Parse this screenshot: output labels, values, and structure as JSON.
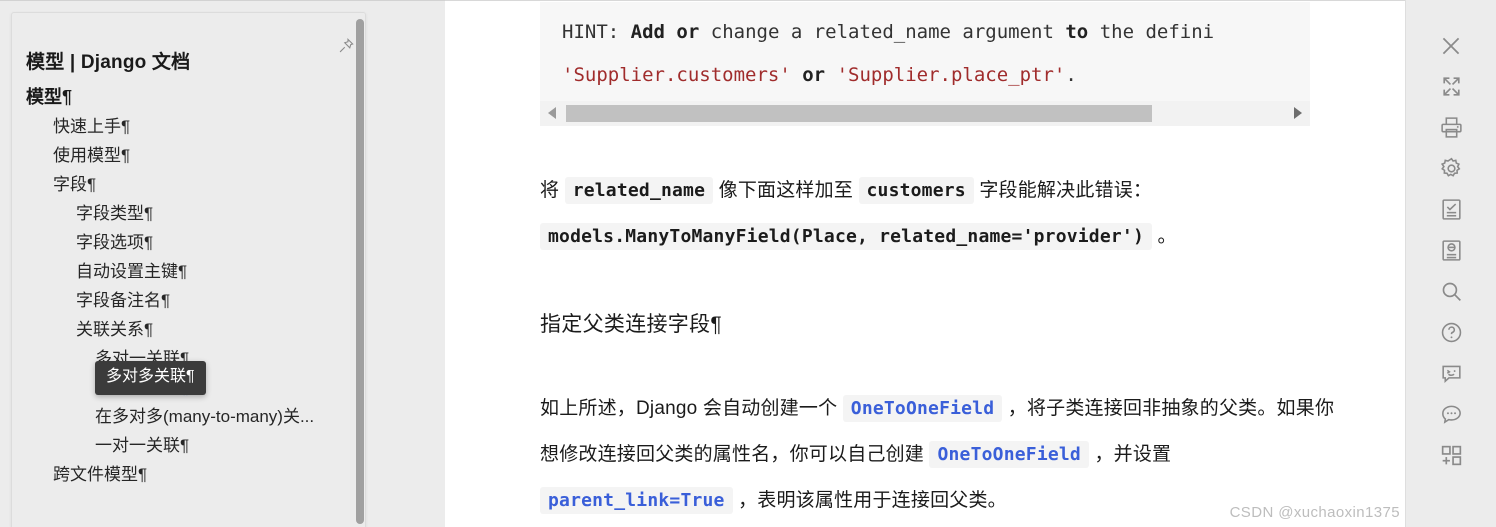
{
  "outline": {
    "title": "模型 | Django 文档",
    "pin_icon": "pin-icon",
    "items": [
      {
        "label": "模型¶",
        "level": 1,
        "bold": true,
        "active": false
      },
      {
        "label": "快速上手¶",
        "level": 2,
        "bold": false,
        "active": false
      },
      {
        "label": "使用模型¶",
        "level": 2,
        "bold": false,
        "active": false
      },
      {
        "label": "字段¶",
        "level": 2,
        "bold": false,
        "active": false
      },
      {
        "label": "字段类型¶",
        "level": 3,
        "bold": false,
        "active": false
      },
      {
        "label": "字段选项¶",
        "level": 3,
        "bold": false,
        "active": false
      },
      {
        "label": "自动设置主键¶",
        "level": 3,
        "bold": false,
        "active": false
      },
      {
        "label": "字段备注名¶",
        "level": 3,
        "bold": false,
        "active": false
      },
      {
        "label": "关联关系¶",
        "level": 3,
        "bold": false,
        "active": false
      },
      {
        "label": "多对一关联¶",
        "level": 4,
        "bold": false,
        "active": false
      },
      {
        "label": "多对多关联¶",
        "level": 4,
        "bold": false,
        "active": true
      },
      {
        "label": "在多对多(many-to-many)关...",
        "level": 4,
        "bold": false,
        "active": false
      },
      {
        "label": "一对一关联¶",
        "level": 4,
        "bold": false,
        "active": false
      },
      {
        "label": "跨文件模型¶",
        "level": 2,
        "bold": false,
        "active": false
      }
    ],
    "tooltip": "多对多关联¶"
  },
  "document": {
    "code_block": {
      "line1": [
        {
          "text": "HINT: ",
          "style": "plain"
        },
        {
          "text": "Add",
          "style": "kw"
        },
        {
          "text": " ",
          "style": "plain"
        },
        {
          "text": "or",
          "style": "kw"
        },
        {
          "text": " change a related_name argument ",
          "style": "plain"
        },
        {
          "text": "to",
          "style": "kw"
        },
        {
          "text": " the defini",
          "style": "plain"
        }
      ],
      "line2": [
        {
          "text": "'Supplier.customers'",
          "style": "str"
        },
        {
          "text": " ",
          "style": "plain"
        },
        {
          "text": "or",
          "style": "kw"
        },
        {
          "text": " ",
          "style": "plain"
        },
        {
          "text": "'Supplier.place_ptr'",
          "style": "str"
        },
        {
          "text": ".",
          "style": "plain"
        }
      ]
    },
    "para_1": [
      {
        "text": "将 ",
        "style": "text"
      },
      {
        "text": "related_name",
        "style": "code"
      },
      {
        "text": " 像下面这样加至 ",
        "style": "text"
      },
      {
        "text": "customers",
        "style": "code"
      },
      {
        "text": " 字段能解决此错误：",
        "style": "text"
      },
      {
        "text": "models.ManyToManyField(Place, related_name='provider')",
        "style": "code"
      },
      {
        "text": " 。",
        "style": "text"
      }
    ],
    "heading": "指定父类连接字段¶",
    "para_2": [
      {
        "text": "如上所述，Django 会自动创建一个 ",
        "style": "text"
      },
      {
        "text": "OneToOneField",
        "style": "codelink"
      },
      {
        "text": " ，将子类连接回非抽象的父类。如果你想修改连接回父类的属性名，你可以自己创建 ",
        "style": "text"
      },
      {
        "text": "OneToOneField",
        "style": "codelink"
      },
      {
        "text": " ，并设置 ",
        "style": "text"
      },
      {
        "text": "parent_link=True",
        "style": "codelink"
      },
      {
        "text": " ，表明该属性用于连接回父类。",
        "style": "text"
      }
    ],
    "hscroll": {
      "left_arrow": "scroll-left-arrow",
      "right_arrow": "scroll-right-arrow"
    }
  },
  "rail": {
    "buttons": [
      {
        "icon": "close-icon",
        "label": "关闭"
      },
      {
        "icon": "expand-icon",
        "label": "全屏"
      },
      {
        "icon": "print-icon",
        "label": "打印"
      },
      {
        "icon": "gear-icon",
        "label": "设置"
      },
      {
        "icon": "checklist-icon",
        "label": "任务"
      },
      {
        "icon": "document-icon",
        "label": "文档"
      },
      {
        "icon": "search-icon",
        "label": "搜索"
      },
      {
        "icon": "help-icon",
        "label": "帮助"
      },
      {
        "icon": "smiley-chat-icon",
        "label": "表情"
      },
      {
        "icon": "message-icon",
        "label": "消息"
      },
      {
        "icon": "apps-add-icon",
        "label": "应用"
      }
    ]
  },
  "watermark": "CSDN @xuchaoxin1375",
  "colors": {
    "panel_bg": "#ececec",
    "accent_link": "#3a5fd9",
    "active_item": "#4f7fe0",
    "tooltip_bg": "#3b3b3b",
    "code_string": "#a02c2c",
    "code_bg": "#f7f7f7"
  }
}
